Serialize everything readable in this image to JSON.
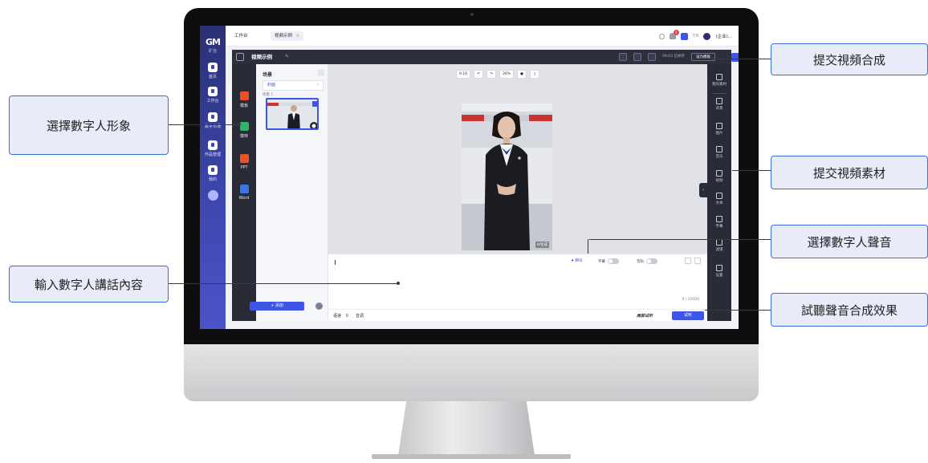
{
  "callouts": {
    "select_avatar": "選擇數字人形象",
    "enter_speech": "輸入數字人講話內容",
    "submit_synthesis": "提交視頻合成",
    "submit_material": "提交視頻素材",
    "select_voice": "選擇數字人聲音",
    "preview_voice": "試聽聲音合成效果"
  },
  "brand": {
    "logo": "GM",
    "subtitle": "矿治"
  },
  "sidebar": {
    "items": [
      {
        "label": "首页"
      },
      {
        "label": "工作台"
      },
      {
        "label": "数字市场"
      },
      {
        "label": "作品管理"
      },
      {
        "label": "我的"
      }
    ]
  },
  "top_bar": {
    "tabs": [
      {
        "label": "工作台"
      },
      {
        "label": "视频示例"
      }
    ],
    "notification_count": "2",
    "lang": "EN",
    "user": "(企业)..."
  },
  "editor": {
    "title": "视频示例",
    "save_time": "09:03 已保存",
    "template_label": "设为模板",
    "compose_label": "合成"
  },
  "tools": [
    {
      "label": "模板",
      "color": "#f04e23"
    },
    {
      "label": "模特",
      "color": "#2fb56a"
    },
    {
      "label": "PPT",
      "color": "#e8542a"
    },
    {
      "label": "Word",
      "color": "#3b73e8"
    }
  ],
  "scene_panel": {
    "title": "场景",
    "tab_label": "封面",
    "scene_num": "场景 1",
    "add_label": "+ 添加"
  },
  "canvas_toolbar": {
    "ratio": "9:16",
    "zoom": "26%"
  },
  "video": {
    "ai_tag": "AI生成"
  },
  "script": {
    "voice_label": "腾讯",
    "subtitle_label": "字幕",
    "bgm_label": "音轨",
    "char_count": "0 / 20000",
    "speed_label": "语速",
    "speed_value": "0",
    "pitch_label": "音调",
    "listen_mode": "局部试听",
    "listen_label": "试听"
  },
  "assets": [
    {
      "label": "我的素材"
    },
    {
      "label": "背景"
    },
    {
      "label": "图片"
    },
    {
      "label": "音乐"
    },
    {
      "label": "视频"
    },
    {
      "label": "文本"
    },
    {
      "label": "字幕"
    },
    {
      "label": "滤镜"
    },
    {
      "label": "设置"
    }
  ],
  "colors": {
    "accent": "#3d56e5",
    "dark_panel": "#292b37",
    "brand": "#3e48b0"
  }
}
